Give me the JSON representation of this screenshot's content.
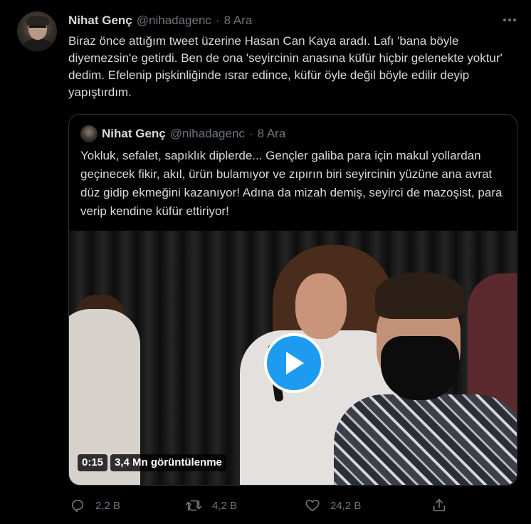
{
  "tweet": {
    "author_name": "Nihat Genç",
    "author_handle": "@nihadagenc",
    "separator": "·",
    "date": "8 Ara",
    "text": "Biraz önce attığım tweet üzerine Hasan Can Kaya aradı. Lafı 'bana böyle diyemezsin'e getirdi. Ben de ona 'seyircinin anasına küfür hiçbir gelenekte yoktur' dedim. Efelenip pişkinliğinde ısrar edince, küfür öyle değil böyle edilir deyip yapıştırdım.",
    "more_icon": "more-dots-icon"
  },
  "quoted": {
    "author_name": "Nihat Genç",
    "author_handle": "@nihadagenc",
    "separator": "·",
    "date": "8 Ara",
    "text": "Yokluk, sefalet, sapıklık diplerde... Gençler galiba para için makul yollardan geçinecek fikir, akıl, ürün bulamıyor ve zıpırın biri seyircinin yüzüne ana avrat düz gidip ekmeğini kazanıyor! Adına da mizah demiş, seyirci de mazoşist, para verip kendine küfür ettiriyor!",
    "video": {
      "duration": "0:15",
      "views": "3,4 Mn görüntülenme",
      "play_icon": "play-icon"
    }
  },
  "actions": {
    "reply_count": "2,2 B",
    "retweet_count": "4,2 B",
    "like_count": "24,2 B"
  },
  "colors": {
    "background": "#000000",
    "text": "#d9d9d9",
    "muted": "#6e767d",
    "accent": "#1d9bf0",
    "border": "#2f3336"
  }
}
